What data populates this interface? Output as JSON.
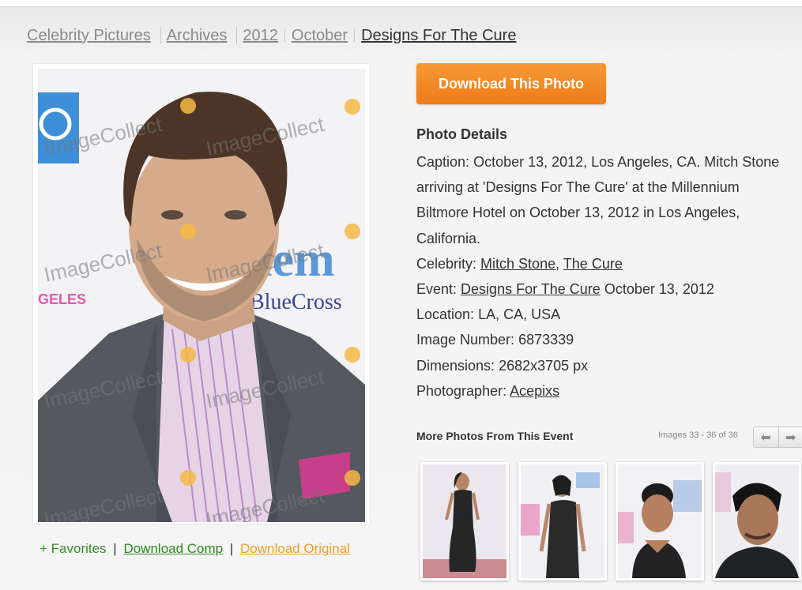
{
  "breadcrumb": {
    "items": [
      "Celebrity Pictures",
      "Archives",
      "2012",
      "October"
    ],
    "current": "Designs For The Cure"
  },
  "photo": {
    "watermark": "ImageCollect",
    "sign_text_1": "BlueCross",
    "sign_text_2": "GELES"
  },
  "actions": {
    "favorites": "+ Favorites",
    "sep": "|",
    "download_comp": "Download Comp",
    "download_original": "Download Original"
  },
  "download_button": "Download This Photo",
  "details": {
    "heading": "Photo Details",
    "caption_label": "Caption:",
    "caption": "October 13, 2012, Los Angeles, CA. Mitch Stone arriving at 'Designs For The Cure' at the Millennium Biltmore Hotel on October 13, 2012 in Los Angeles, California.",
    "celebrity_label": "Celebrity:",
    "celebrities": [
      "Mitch Stone",
      "The Cure"
    ],
    "celebrity_sep": ",",
    "event_label": "Event:",
    "event_link": "Designs For The Cure",
    "event_date": "October 13, 2012",
    "location_label": "Location:",
    "location": "LA, CA, USA",
    "image_number_label": "Image Number:",
    "image_number": "6873339",
    "dimensions_label": "Dimensions:",
    "dimensions": "2682x3705 px",
    "photographer_label": "Photographer:",
    "photographer": "Acepixs"
  },
  "more": {
    "title": "More Photos From This Event",
    "count": "Images 33 - 36 of 36",
    "prev_icon": "arrow-left-icon",
    "next_icon": "arrow-right-icon"
  },
  "colors": {
    "button": "#ee7a1a",
    "link_green": "#2a8a1e",
    "link_orange": "#f0a020"
  }
}
